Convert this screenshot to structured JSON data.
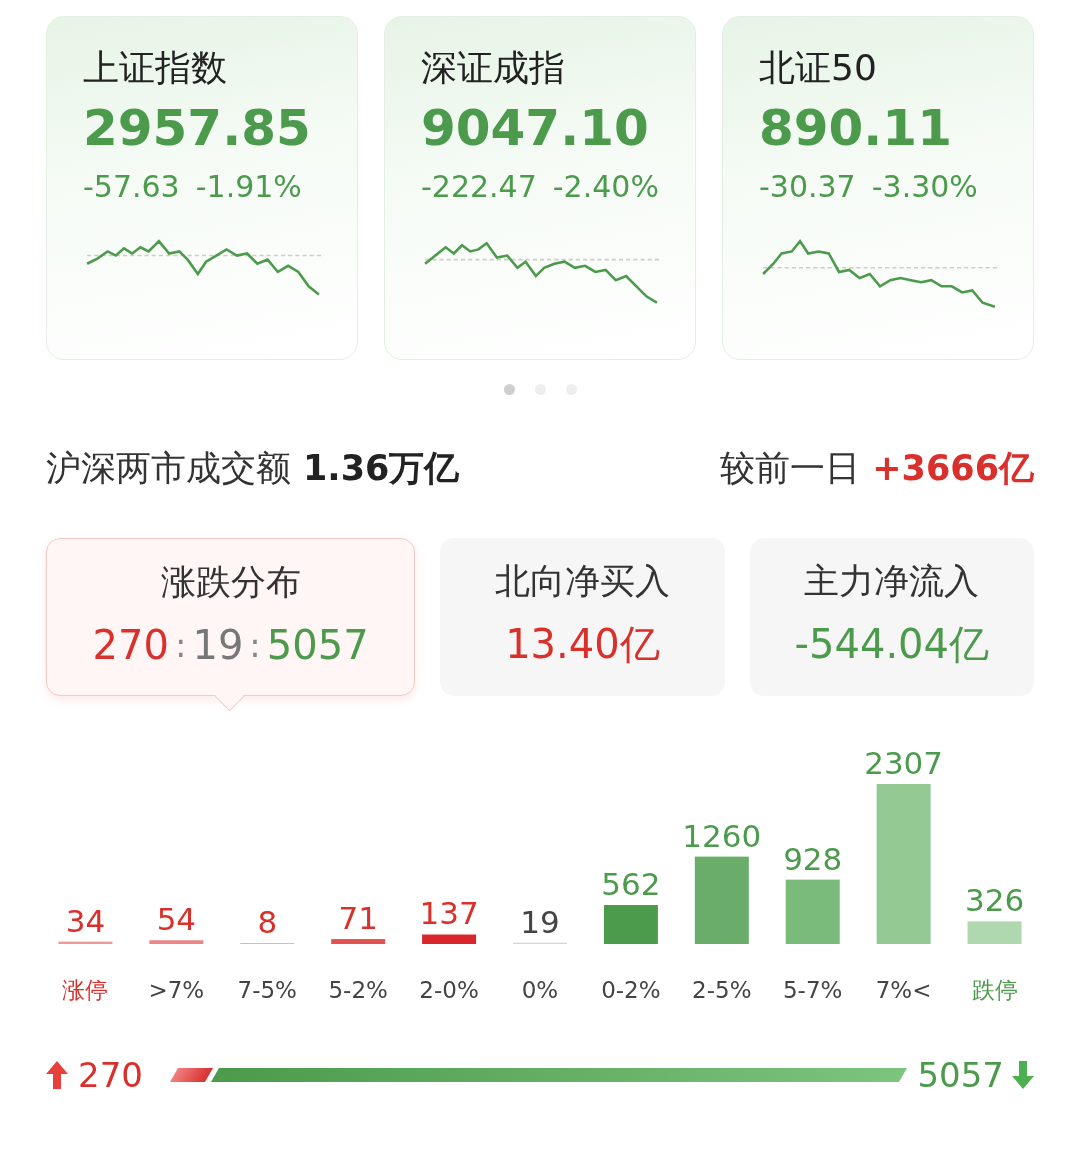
{
  "index_cards": [
    {
      "name": "上证指数",
      "price": "2957.85",
      "change": "-57.63",
      "percent": "-1.91%"
    },
    {
      "name": "深证成指",
      "price": "9047.10",
      "change": "-222.47",
      "percent": "-2.40%"
    },
    {
      "name": "北证50",
      "price": "890.11",
      "change": "-30.37",
      "percent": "-3.30%"
    }
  ],
  "pager": [
    {
      "selected": true
    },
    {
      "selected": false
    },
    {
      "selected": false
    }
  ],
  "turnover": {
    "label": "沪深两市成交额",
    "value": "1.36万亿",
    "compare_label": "较前一日",
    "compare_value": "+3666亿"
  },
  "stat_tabs": [
    {
      "kind": "ratio",
      "title": "涨跌分布",
      "parts": [
        {
          "kind": "up",
          "text": "270"
        },
        {
          "kind": "sep",
          "text": ":"
        },
        {
          "kind": "flat",
          "text": "19"
        },
        {
          "kind": "sep",
          "text": ":"
        },
        {
          "kind": "down",
          "text": "5057"
        }
      ],
      "selected": true
    },
    {
      "kind": "amount",
      "title": "北向净买入",
      "value": "13.40亿",
      "color": "#d9302c",
      "selected": false
    },
    {
      "kind": "amount",
      "title": "主力净流入",
      "value": "-544.04亿",
      "color": "#4c9a4c",
      "selected": false
    }
  ],
  "distribution": {
    "chart_data": {
      "type": "bar",
      "categories": [
        "涨停",
        ">7%",
        "7-5%",
        "5-2%",
        "2-0%",
        "0%",
        "0-2%",
        "2-5%",
        "5-7%",
        "7%<",
        "跌停"
      ],
      "values": [
        34,
        54,
        8,
        71,
        137,
        19,
        562,
        1260,
        928,
        2307,
        326
      ],
      "data_labels": true
    }
  },
  "balance": {
    "up": "270",
    "down": "5057",
    "level": 0.05
  }
}
